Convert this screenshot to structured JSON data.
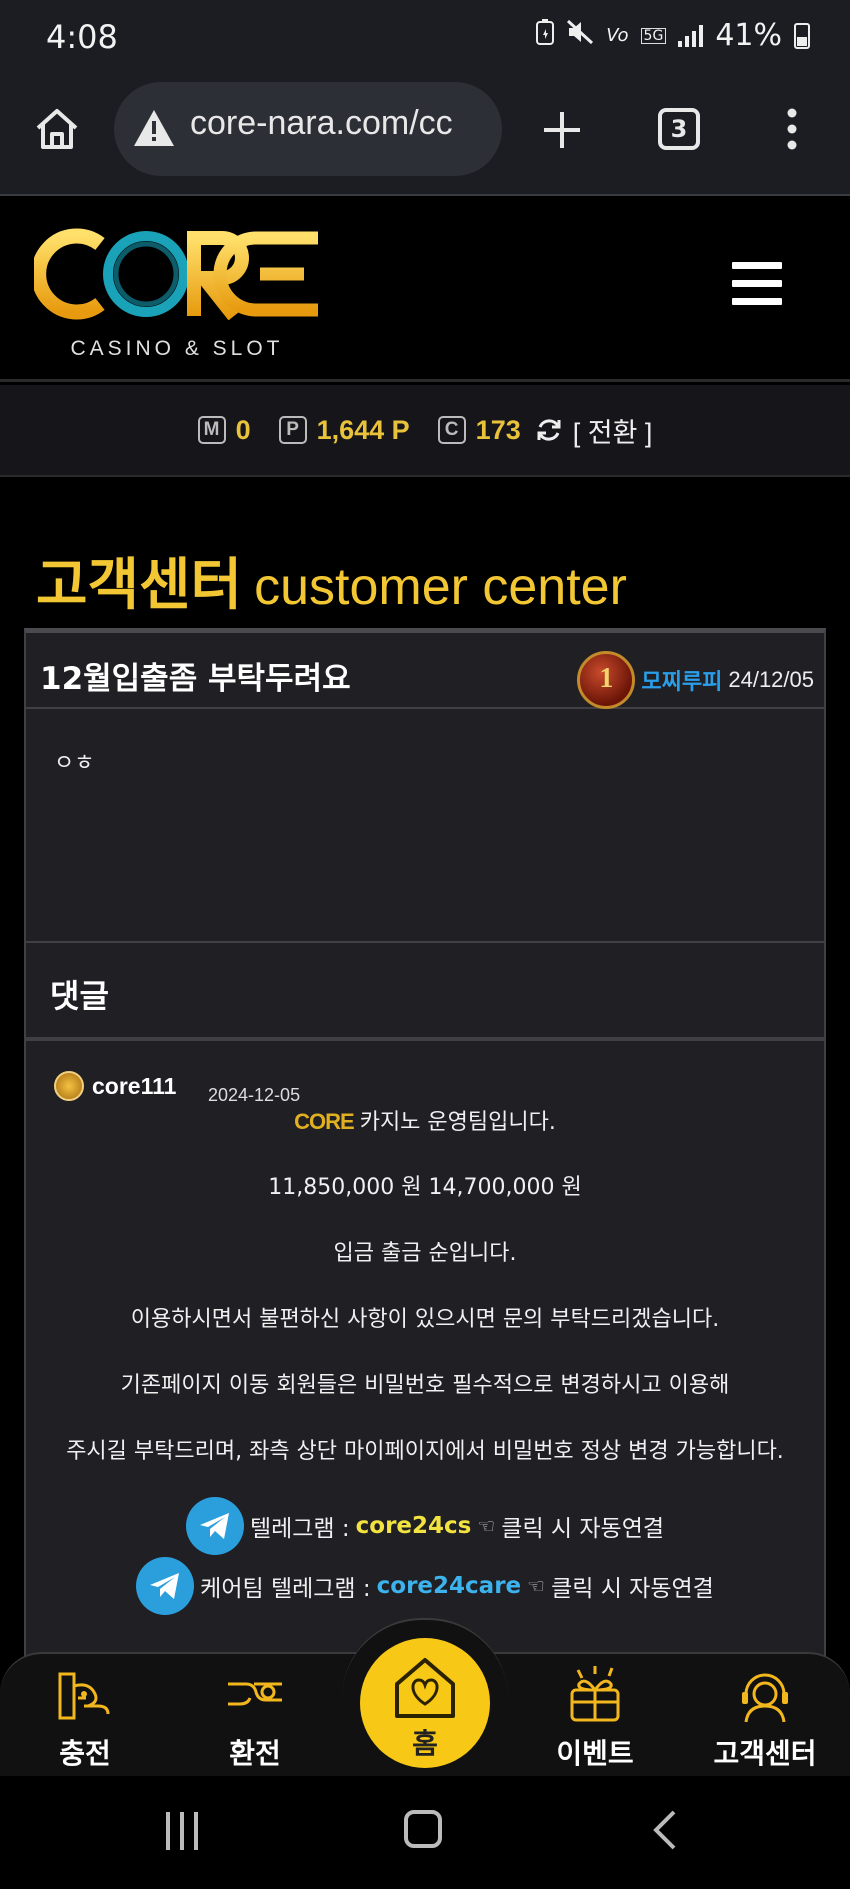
{
  "status_bar": {
    "time": "4:08",
    "network_badge": "5G",
    "volte": "Vo",
    "battery": "41%"
  },
  "browser": {
    "url": "core-nara.com/cc",
    "tab_count": "3"
  },
  "site": {
    "logo_text": "CORE",
    "logo_subtitle": "CASINO & SLOT",
    "logo_colors": {
      "gold": "#f3b71e",
      "teal": "#1aa2b8"
    }
  },
  "points": {
    "money_icon": "M",
    "money": "0",
    "point_icon": "P",
    "point": "1,644 P",
    "coin_icon": "C",
    "coin": "173",
    "switch_label": "[ 전환 ]"
  },
  "page": {
    "title_ko": "고객센터",
    "title_en": "customer center"
  },
  "post": {
    "title": "12월입출좀 부탁두려요",
    "level": "1",
    "author": "모찌루피",
    "date": "24/12/05",
    "content": "ㅇㅎ"
  },
  "comments": {
    "section_label": "댓글",
    "items": [
      {
        "user": "core111",
        "date": "2024-12-05",
        "logo_mini": "CORE",
        "lines": [
          "카지노 운영팀입니다.",
          "11,850,000 원 14,700,000 원",
          "입금 출금 순입니다.",
          "이용하시면서 불편하신 사항이 있으시면 문의 부탁드리겠습니다.",
          "기존페이지 이동 회원들은 비밀번호 필수적으로 변경하시고 이용해",
          "주시길 부탁드리며, 좌측 상단 마이페이지에서 비밀번호 정상 변경 가능합니다."
        ],
        "telegram_1": {
          "prefix": "텔레그램 : ",
          "handle": "core24cs",
          "suffix": "클릭 시 자동연결"
        },
        "telegram_2": {
          "prefix": "케어팀 텔레그램 : ",
          "handle": "core24care",
          "suffix": "클릭 시 자동연결"
        }
      }
    ]
  },
  "bottom_nav": {
    "charge": "충전",
    "exchange": "환전",
    "home": "홈",
    "event": "이벤트",
    "support": "고객센터",
    "accent": "#f8c817"
  }
}
